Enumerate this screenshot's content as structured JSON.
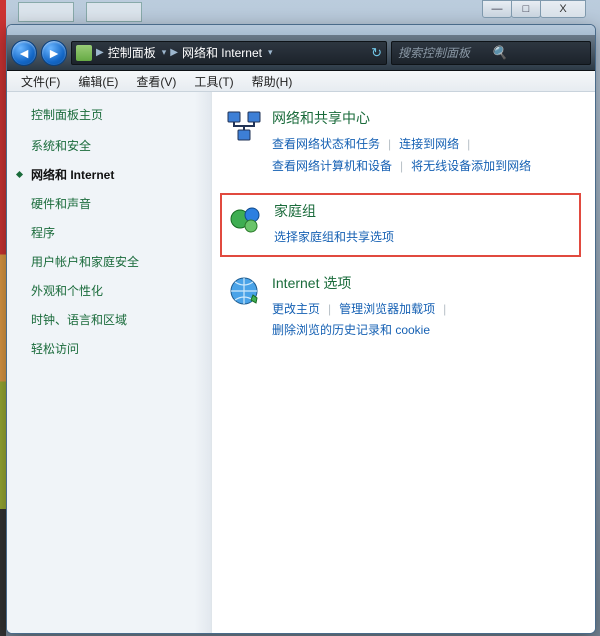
{
  "desktop": {},
  "window_controls": {
    "min": "—",
    "max": "□",
    "close": "X"
  },
  "nav": {
    "back_glyph": "◄",
    "fwd_glyph": "►",
    "crumb1": "控制面板",
    "crumb2": "网络和 Internet",
    "sep_glyph": "▶",
    "dd_glyph": "▾",
    "refresh_glyph": "↻"
  },
  "search": {
    "placeholder": "搜索控制面板",
    "mag_glyph": "🔍"
  },
  "menu": {
    "file": "文件(F)",
    "edit": "编辑(E)",
    "view": "查看(V)",
    "tools": "工具(T)",
    "help": "帮助(H)"
  },
  "sidebar": {
    "home": "控制面板主页",
    "items": [
      "系统和安全",
      "网络和 Internet",
      "硬件和声音",
      "程序",
      "用户帐户和家庭安全",
      "外观和个性化",
      "时钟、语言和区域",
      "轻松访问"
    ],
    "current_index": 1
  },
  "sections": [
    {
      "title": "网络和共享中心",
      "links": [
        "查看网络状态和任务",
        "连接到网络",
        "查看网络计算机和设备",
        "将无线设备添加到网络"
      ],
      "highlight": false,
      "icon": "network"
    },
    {
      "title": "家庭组",
      "links": [
        "选择家庭组和共享选项"
      ],
      "highlight": true,
      "icon": "homegroup"
    },
    {
      "title": "Internet 选项",
      "links": [
        "更改主页",
        "管理浏览器加载项",
        "删除浏览的历史记录和 cookie"
      ],
      "highlight": false,
      "icon": "internet"
    }
  ]
}
